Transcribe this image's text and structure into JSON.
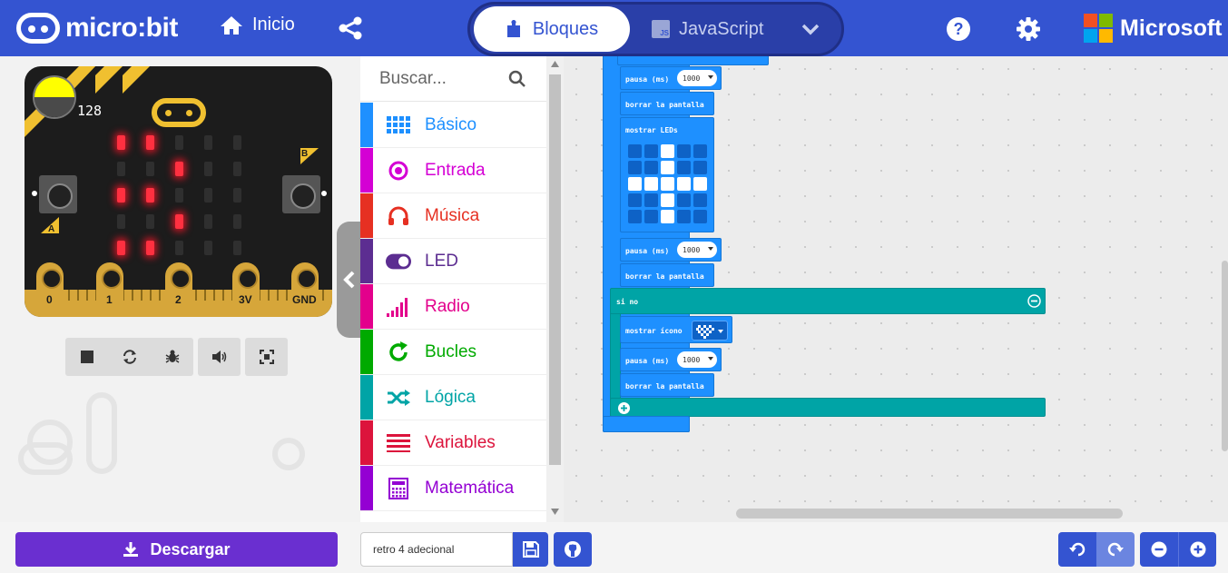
{
  "header": {
    "brand": "micro:bit",
    "home_label": "Inicio",
    "mode_blocks_label": "Bloques",
    "mode_js_label": "JavaScript",
    "js_badge": "JS",
    "ms_label": "Microsoft",
    "icons": [
      "home-icon",
      "share-icon",
      "puzzle-icon",
      "chevron-down-icon",
      "help-icon",
      "gear-icon"
    ]
  },
  "simulator": {
    "light_level": "128",
    "light_level_fraction": 0.5,
    "button_a_label": "A",
    "button_b_label": "B",
    "pins": [
      "0",
      "1",
      "2",
      "3V",
      "GND"
    ],
    "led_matrix": [
      [
        1,
        1,
        0,
        0,
        0
      ],
      [
        0,
        0,
        1,
        0,
        0
      ],
      [
        1,
        1,
        0,
        0,
        0
      ],
      [
        0,
        0,
        1,
        0,
        0
      ],
      [
        1,
        1,
        0,
        0,
        0
      ]
    ],
    "led_color": "#ff3040",
    "toolbar_icons": [
      "stop-icon",
      "restart-icon",
      "debug-icon",
      "sound-icon",
      "fullscreen-icon"
    ]
  },
  "toolbox": {
    "search_placeholder": "Buscar...",
    "categories": [
      {
        "label": "Básico",
        "color": "#1e90ff",
        "icon": "grid-icon"
      },
      {
        "label": "Entrada",
        "color": "#d400d4",
        "icon": "target-icon"
      },
      {
        "label": "Música",
        "color": "#e63022",
        "icon": "headphones-icon"
      },
      {
        "label": "LED",
        "color": "#5c2d91",
        "icon": "toggle-icon"
      },
      {
        "label": "Radio",
        "color": "#e3008c",
        "icon": "signal-icon"
      },
      {
        "label": "Bucles",
        "color": "#00aa00",
        "icon": "loop-icon"
      },
      {
        "label": "Lógica",
        "color": "#00a4a6",
        "icon": "shuffle-icon"
      },
      {
        "label": "Variables",
        "color": "#dc143c",
        "icon": "lines-icon"
      },
      {
        "label": "Matemática",
        "color": "#9400d3",
        "icon": "calculator-icon"
      }
    ]
  },
  "workspace": {
    "pause_label": "pausa (ms)",
    "pause_value": "1000",
    "clear_label": "borrar la pantalla",
    "show_leds_label": "mostrar LEDs",
    "show_icon_label": "mostrar ícono",
    "else_label": "si no",
    "led_editor": [
      [
        0,
        0,
        1,
        0,
        0
      ],
      [
        0,
        0,
        1,
        0,
        0
      ],
      [
        1,
        1,
        1,
        1,
        1
      ],
      [
        0,
        0,
        1,
        0,
        0
      ],
      [
        0,
        0,
        1,
        0,
        0
      ]
    ],
    "colors": {
      "basic": "#1e90ff",
      "logic": "#00a4a6",
      "input": "#c51f9e"
    }
  },
  "footer": {
    "download_label": "Descargar",
    "project_name": "retro 4 adecional",
    "icons": [
      "download-icon",
      "save-icon",
      "github-icon",
      "undo-icon",
      "redo-icon",
      "zoom-out-icon",
      "zoom-in-icon"
    ]
  }
}
